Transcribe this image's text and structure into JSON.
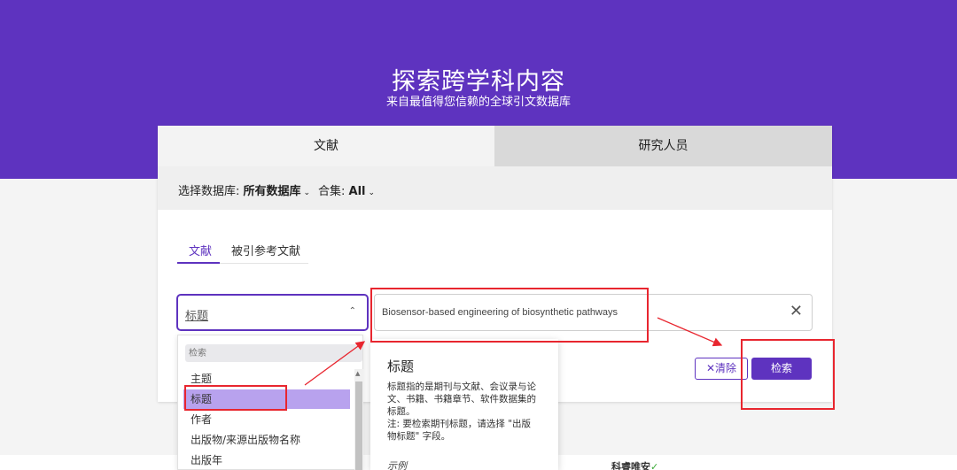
{
  "hero": {
    "title": "探索跨学科内容",
    "subtitle": "来自最值得您信赖的全球引文数据库"
  },
  "tabs": [
    {
      "label": "文献",
      "active": true
    },
    {
      "label": "研究人员",
      "active": false
    }
  ],
  "database_row": {
    "label": "选择数据库:",
    "value": "所有数据库",
    "collection_label": "合集:",
    "collection_value": "All"
  },
  "subtabs": [
    {
      "label": "文献",
      "active": true
    },
    {
      "label": "被引参考文献",
      "active": false
    }
  ],
  "field_select": {
    "value": "标题"
  },
  "search": {
    "value": "Biosensor-based engineering of biosynthetic pathways"
  },
  "buttons": {
    "clear": "清除",
    "search": "检索"
  },
  "dropdown": {
    "search_placeholder": "检索",
    "items": [
      {
        "label": "主题",
        "selected": false
      },
      {
        "label": "标题",
        "selected": true
      },
      {
        "label": "作者",
        "selected": false
      },
      {
        "label": "出版物/来源出版物名称",
        "selected": false
      },
      {
        "label": "出版年",
        "selected": false
      }
    ]
  },
  "tooltip": {
    "title": "标题",
    "body": "标题指的是期刊与文献、会议录与论文、书籍、书籍章节、软件数据集的标题。",
    "note": "注: 要检索期刊标题，请选择 \"出版物标题\" 字段。",
    "example_label": "示例"
  },
  "footer_logo": "科睿唯安",
  "colors": {
    "brand": "#5e33bf",
    "annotation": "#e8262f",
    "dropdown_selected": "#b8a2ee"
  }
}
